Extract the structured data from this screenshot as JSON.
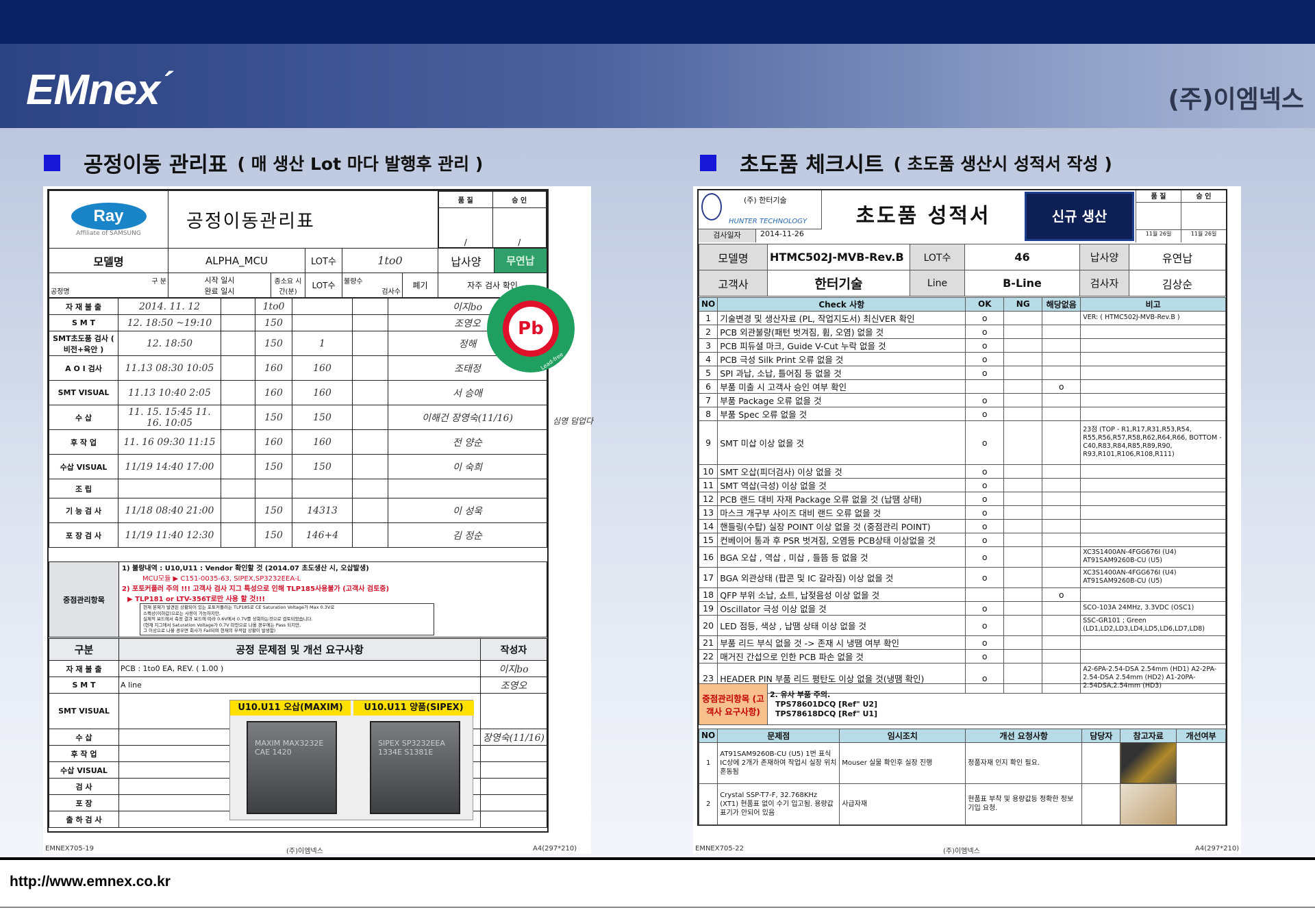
{
  "header": {
    "logo": "EMnex",
    "logo_accent": "´",
    "company": "(주)이엠넥스"
  },
  "left_section": {
    "title": "공정이동 관리표",
    "subtitle": "( 매 생산 Lot 마다 발행후 관리 )"
  },
  "right_section": {
    "title": "초도품 체크시트",
    "subtitle": "( 초도품 생산시 성적서 작성 )"
  },
  "left_form": {
    "brand": "Ray",
    "brand_tag": "Affiliate of SAMSUNG",
    "title": "공정이동관리표",
    "approval": [
      "품 질",
      "승 인"
    ],
    "approval_slash": "/",
    "model_label": "모델명",
    "model": "ALPHA_MCU",
    "lot_label": "LOT수",
    "lot": "1to0",
    "spec_label": "납사양",
    "spec": "무연납",
    "cols": [
      "구 분",
      "공정명",
      "시작 일시",
      "완료 일시",
      "종소요 시간(분)",
      "LOT수",
      "불량수",
      "검사수",
      "폐기",
      "자주 검사 확인"
    ],
    "rows": [
      {
        "name": "자 재 불 출",
        "time": "2014. 11. 12",
        "lot": "1to0",
        "sign": "이지bo"
      },
      {
        "name": "S M T",
        "time": "12. 18:50 ~19:10",
        "lot": "150",
        "sign": "조영오"
      },
      {
        "name": "SMT초도품 검사 ( 비전+육안 )",
        "time": "12. 18:50",
        "lot": "150",
        "insp": "1",
        "sign": "정해"
      },
      {
        "name": "A O I 검사",
        "time": "11.13 08:30 10:05",
        "lot": "160",
        "insp": "160",
        "sign": "조태정"
      },
      {
        "name": "SMT VISUAL",
        "time": "11.13 10:40 2:05",
        "lot": "160",
        "insp": "160",
        "sign": "서 승애"
      },
      {
        "name": "수 삽",
        "time": "11. 15. 15:45 11. 16. 10:05",
        "lot": "150",
        "insp": "150",
        "sign": "이해건 장영숙(11/16)"
      },
      {
        "name": "후 작 업",
        "time": "11. 16 09:30 11:15",
        "lot": "160",
        "insp": "160",
        "sign": "전 양순"
      },
      {
        "name": "수삽 VISUAL",
        "time": "11/19 14:40 17:00",
        "lot": "150",
        "insp": "150",
        "sign": "이 숙희"
      },
      {
        "name": "조 립",
        "time": "",
        "lot": "",
        "insp": "",
        "sign": ""
      },
      {
        "name": "기 능 검 사",
        "time": "11/18 08:40 21:00",
        "lot": "150",
        "insp": "14313",
        "sign": "이 성욱"
      },
      {
        "name": "포 장 검 사",
        "time": "11/19 11:40 12:30",
        "lot": "150",
        "insp": "146+4",
        "sign": "김 정순"
      }
    ],
    "side_note": "심영 덤업다",
    "stamp": "Pb",
    "stamp_text": "Lead-free",
    "key_label": "중점관리항목",
    "key_lines": [
      "1) 불량내역 : U10,U11 : Vendor 확인할 것 (2014.07 초도생산 시, 오삽발생)",
      "MCU모듈 ▶ C151-0035-63, SIPEX,SP3232EEA-L",
      "2) 포토커플러 주의 !!! 고객사 검사 지그 특성으로 인해 TLP185사용불가 (고객사 검토중)",
      "▶ TLP181 or LTV-356T로만 사용 할 것!!!"
    ],
    "key_box": [
      "현재 본제가 발견된 상황되어 있는 포토커플러는 TLP185로 CE Saturation Voltage가 Max 0.3V로",
      "스펙상(이하값)으로는 사용이 가능하지만,",
      "실제적 보드에서 측정 결과 보드에 따라 0.6V에서 0.7V를 상회하는것으로 검토되었습니다.",
      "(현재 지그에서 Saturation Voltage가 0.7V 미만으로 나올 경우에는 Pass 되지만,",
      "그 이상으로 나올 경우면 회사가 Fail되며 현재의 부적합 상황이 발생함)"
    ],
    "bottom_head": [
      "구분",
      "공정 문제점 및 개선 요구사항",
      "작성자"
    ],
    "bottom_rows": [
      "자 재 불 출",
      "S M T",
      "SMT VISUAL",
      "수 삽",
      "후 작 업",
      "수삽 VISUAL",
      "검 사",
      "포 장",
      "출 하 검 사"
    ],
    "bottom_issue1": "PCB : 1to0 EA, REV. ( 1.00 )",
    "bottom_issue2": "A line",
    "bottom_writer1": "이지bo",
    "bottom_writer2": "조영오",
    "bottom_writer3": "장영숙(11/16)",
    "chip_a_label": "U10.U11 오삽(MAXIM)",
    "chip_a_text": "MAXIM MAX3232E CAE 1420",
    "chip_b_label": "U10.U11 양품(SIPEX)",
    "chip_b_text": "SIPEX SP3232EEA 1334E S1381E",
    "footer": [
      "EMNEX705-19",
      "(주)이엠넥스",
      "A4(297*210)"
    ]
  },
  "right_form": {
    "company_small": "(주) 한터기술",
    "company_en": "HUNTER TECHNOLOGY",
    "date_label": "검사일자",
    "date": "2014-11-26",
    "title": "초도품 성적서",
    "badge": "신규 생산",
    "approval": [
      "품 질",
      "승 인"
    ],
    "approval_dates": [
      "11월 26일",
      "11월 26일"
    ],
    "model_label": "모델명",
    "model": "HTMC502J-MVB-Rev.B",
    "lot_label": "LOT수",
    "lot": "46",
    "spec_label": "납사양",
    "spec": "유연납",
    "customer_label": "고객사",
    "customer": "한터기술",
    "line_label": "Line",
    "line": "B-Line",
    "inspector_label": "검사자",
    "inspector": "김상순",
    "check_head": [
      "NO",
      "Check 사항",
      "OK",
      "NG",
      "해당없음",
      "비고"
    ],
    "checks": [
      {
        "no": "1",
        "item": "기술변경 및 생산자료 (PL, 작업지도서) 최신VER 확인",
        "ok": "o",
        "na": "",
        "note": "VER: ( HTMC502J-MVB-Rev.B )"
      },
      {
        "no": "2",
        "item": "PCB 외관불량(패턴 벗겨짐, 휨, 오염) 없을 것",
        "ok": "o",
        "na": "",
        "note": ""
      },
      {
        "no": "3",
        "item": "PCB 피듀셜 마크, Guide V-Cut 누락 없을 것",
        "ok": "o",
        "na": "",
        "note": ""
      },
      {
        "no": "4",
        "item": "PCB 극성 Silk Print 오류 없을 것",
        "ok": "o",
        "na": "",
        "note": ""
      },
      {
        "no": "5",
        "item": "SPI 과납, 소납, 틀어짐 등 없을 것",
        "ok": "o",
        "na": "",
        "note": ""
      },
      {
        "no": "6",
        "item": "부품 미출 시 고객사 승인 여부 확인",
        "ok": "",
        "na": "o",
        "note": ""
      },
      {
        "no": "7",
        "item": "부품 Package 오류 없을 것",
        "ok": "o",
        "na": "",
        "note": ""
      },
      {
        "no": "8",
        "item": "부품 Spec 오류 없을 것",
        "ok": "o",
        "na": "",
        "note": ""
      },
      {
        "no": "9",
        "item": "SMT 미삽 이상 없을 것",
        "ok": "o",
        "na": "",
        "note": "23점 (TOP - R1,R17,R31,R53,R54, R55,R56,R57,R58,R62,R64,R66, BOTTOM - C40,R83,R84,R85,R89,R90, R93,R101,R106,R108,R111)"
      },
      {
        "no": "10",
        "item": "SMT 오삽(피더검사) 이상 없을 것",
        "ok": "o",
        "na": "",
        "note": ""
      },
      {
        "no": "11",
        "item": "SMT 역삽(극성) 이상 없을 것",
        "ok": "o",
        "na": "",
        "note": ""
      },
      {
        "no": "12",
        "item": "PCB 랜드 대비 자재 Package 오류 없을 것 (납땜 상태)",
        "ok": "o",
        "na": "",
        "note": ""
      },
      {
        "no": "13",
        "item": "마스크 개구부 사이즈 대비 랜드 오류 없을 것",
        "ok": "o",
        "na": "",
        "note": ""
      },
      {
        "no": "14",
        "item": "핸들링(수탑) 실장 POINT 이상 없을 것 (중점관리 POINT)",
        "ok": "o",
        "na": "",
        "note": ""
      },
      {
        "no": "15",
        "item": "컨베이어 통과 후 PSR 벗겨짐, 오염등 PCB상태 이상없을 것",
        "ok": "o",
        "na": "",
        "note": ""
      },
      {
        "no": "16",
        "item": "BGA 오삽 , 역삽 , 미삽 , 들뜸 등 없을 것",
        "ok": "o",
        "na": "",
        "note": "XC3S1400AN-4FGG676I (U4) AT91SAM9260B-CU (U5)"
      },
      {
        "no": "17",
        "item": "BGA 외관상태 (팝콘 및 IC 갈라짐) 이상 없을 것",
        "ok": "o",
        "na": "",
        "note": "XC3S1400AN-4FGG676I (U4) AT91SAM9260B-CU (U5)"
      },
      {
        "no": "18",
        "item": "QFP 부위 소납, 쇼트, 납젖음성 이상 없을 것",
        "ok": "",
        "na": "o",
        "note": ""
      },
      {
        "no": "19",
        "item": "Oscillator 극성 이상 없을 것",
        "ok": "o",
        "na": "",
        "note": "SCO-103A 24MHz, 3.3VDC (OSC1)"
      },
      {
        "no": "20",
        "item": "LED 점등, 색상 , 납땜 상태 이상 없을 것",
        "ok": "o",
        "na": "",
        "note": "SSC-GR101 ; Green (LD1,LD2,LD3,LD4,LD5,LD6,LD7,LD8)"
      },
      {
        "no": "21",
        "item": "부품 리드 부식 없을 것 -> 존재 시 냉땜 여부 확인",
        "ok": "o",
        "na": "",
        "note": ""
      },
      {
        "no": "22",
        "item": "매거진 간섭으로 인한 PCB 파손 없을 것",
        "ok": "o",
        "na": "",
        "note": ""
      },
      {
        "no": "23",
        "item": "HEADER PIN 부품 리드 평탄도 이상 없을 것(냉땜 확인)",
        "ok": "o",
        "na": "",
        "note": "A2-6PA-2.54-DSA 2.54mm (HD1) A2-2PA-2.54-DSA 2.54mm (HD2) A1-20PA-2.54DSA,2.54mm (HD3)"
      }
    ],
    "key_label": "중점관리항목 (고객사 요구사항)",
    "key_lines": [
      "2. 유사 부품 주의.",
      "TPS78601DCQ [Ref\" U2]",
      "TPS78618DCQ [Ref\" U1]"
    ],
    "issue_head": [
      "NO",
      "문제점",
      "임시조치",
      "개선 요청사항",
      "담당자",
      "참고자료",
      "개선여부"
    ],
    "issues": [
      {
        "no": "1",
        "problem": "AT91SAM9260B-CU (U5) 1번 표식 IC상에 2개가 존재하여 작업시 실장 위치 혼동됨",
        "temp": "Mouser 실물 확인후 실장 진행",
        "req": "정품자재 인지 확인 필요."
      },
      {
        "no": "2",
        "problem": "Crystal SSP-T7-F, 32.768KHz (XT1) 현품표 없이 수기 입고됨. 용량값 표기가 안되어 있음",
        "temp": "사급자재",
        "req": "현품표 부착 및 용량값등 정확한 정보 기입 요청."
      }
    ],
    "footer": [
      "EMNEX705-22",
      "(주)이엠넥스",
      "A4(297*210)"
    ]
  },
  "url": "http://www.emnex.co.kr"
}
